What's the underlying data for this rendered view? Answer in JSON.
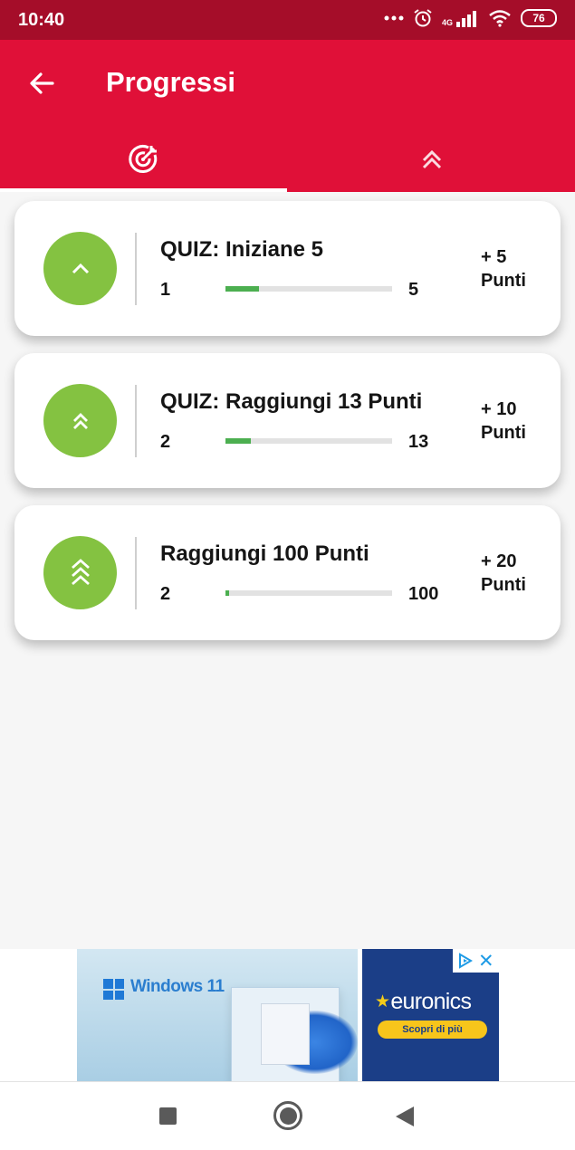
{
  "status_bar": {
    "time": "10:40",
    "signal_label": "4G",
    "battery": "76"
  },
  "app_bar": {
    "title": "Progressi"
  },
  "tabs": [
    {
      "icon": "target-icon",
      "selected": true
    },
    {
      "icon": "double-chevron-up-icon",
      "selected": false
    }
  ],
  "achievements": [
    {
      "title": "QUIZ: Iniziane 5",
      "current": "1",
      "target": "5",
      "progress_fraction": 0.2,
      "reward_line1": "+ 5",
      "reward_line2": "Punti",
      "icon": "chevron-up-icon"
    },
    {
      "title": "QUIZ: Raggiungi 13 Punti",
      "current": "2",
      "target": "13",
      "progress_fraction": 0.154,
      "reward_line1": "+ 10",
      "reward_line2": "Punti",
      "icon": "double-chevron-up-icon"
    },
    {
      "title": "Raggiungi 100 Punti",
      "current": "2",
      "target": "100",
      "progress_fraction": 0.02,
      "reward_line1": "+ 20",
      "reward_line2": "Punti",
      "icon": "triple-chevron-up-icon"
    }
  ],
  "ad": {
    "windows_text": "Windows 11",
    "brand": "euronics",
    "cta": "Scopri di più",
    "close_glyph": "✕"
  },
  "colors": {
    "status_bar": "#a50d29",
    "app_bar": "#e01038",
    "badge": "#84c241",
    "progress_fill": "#4caf50",
    "progress_track": "#e2e2e2"
  }
}
